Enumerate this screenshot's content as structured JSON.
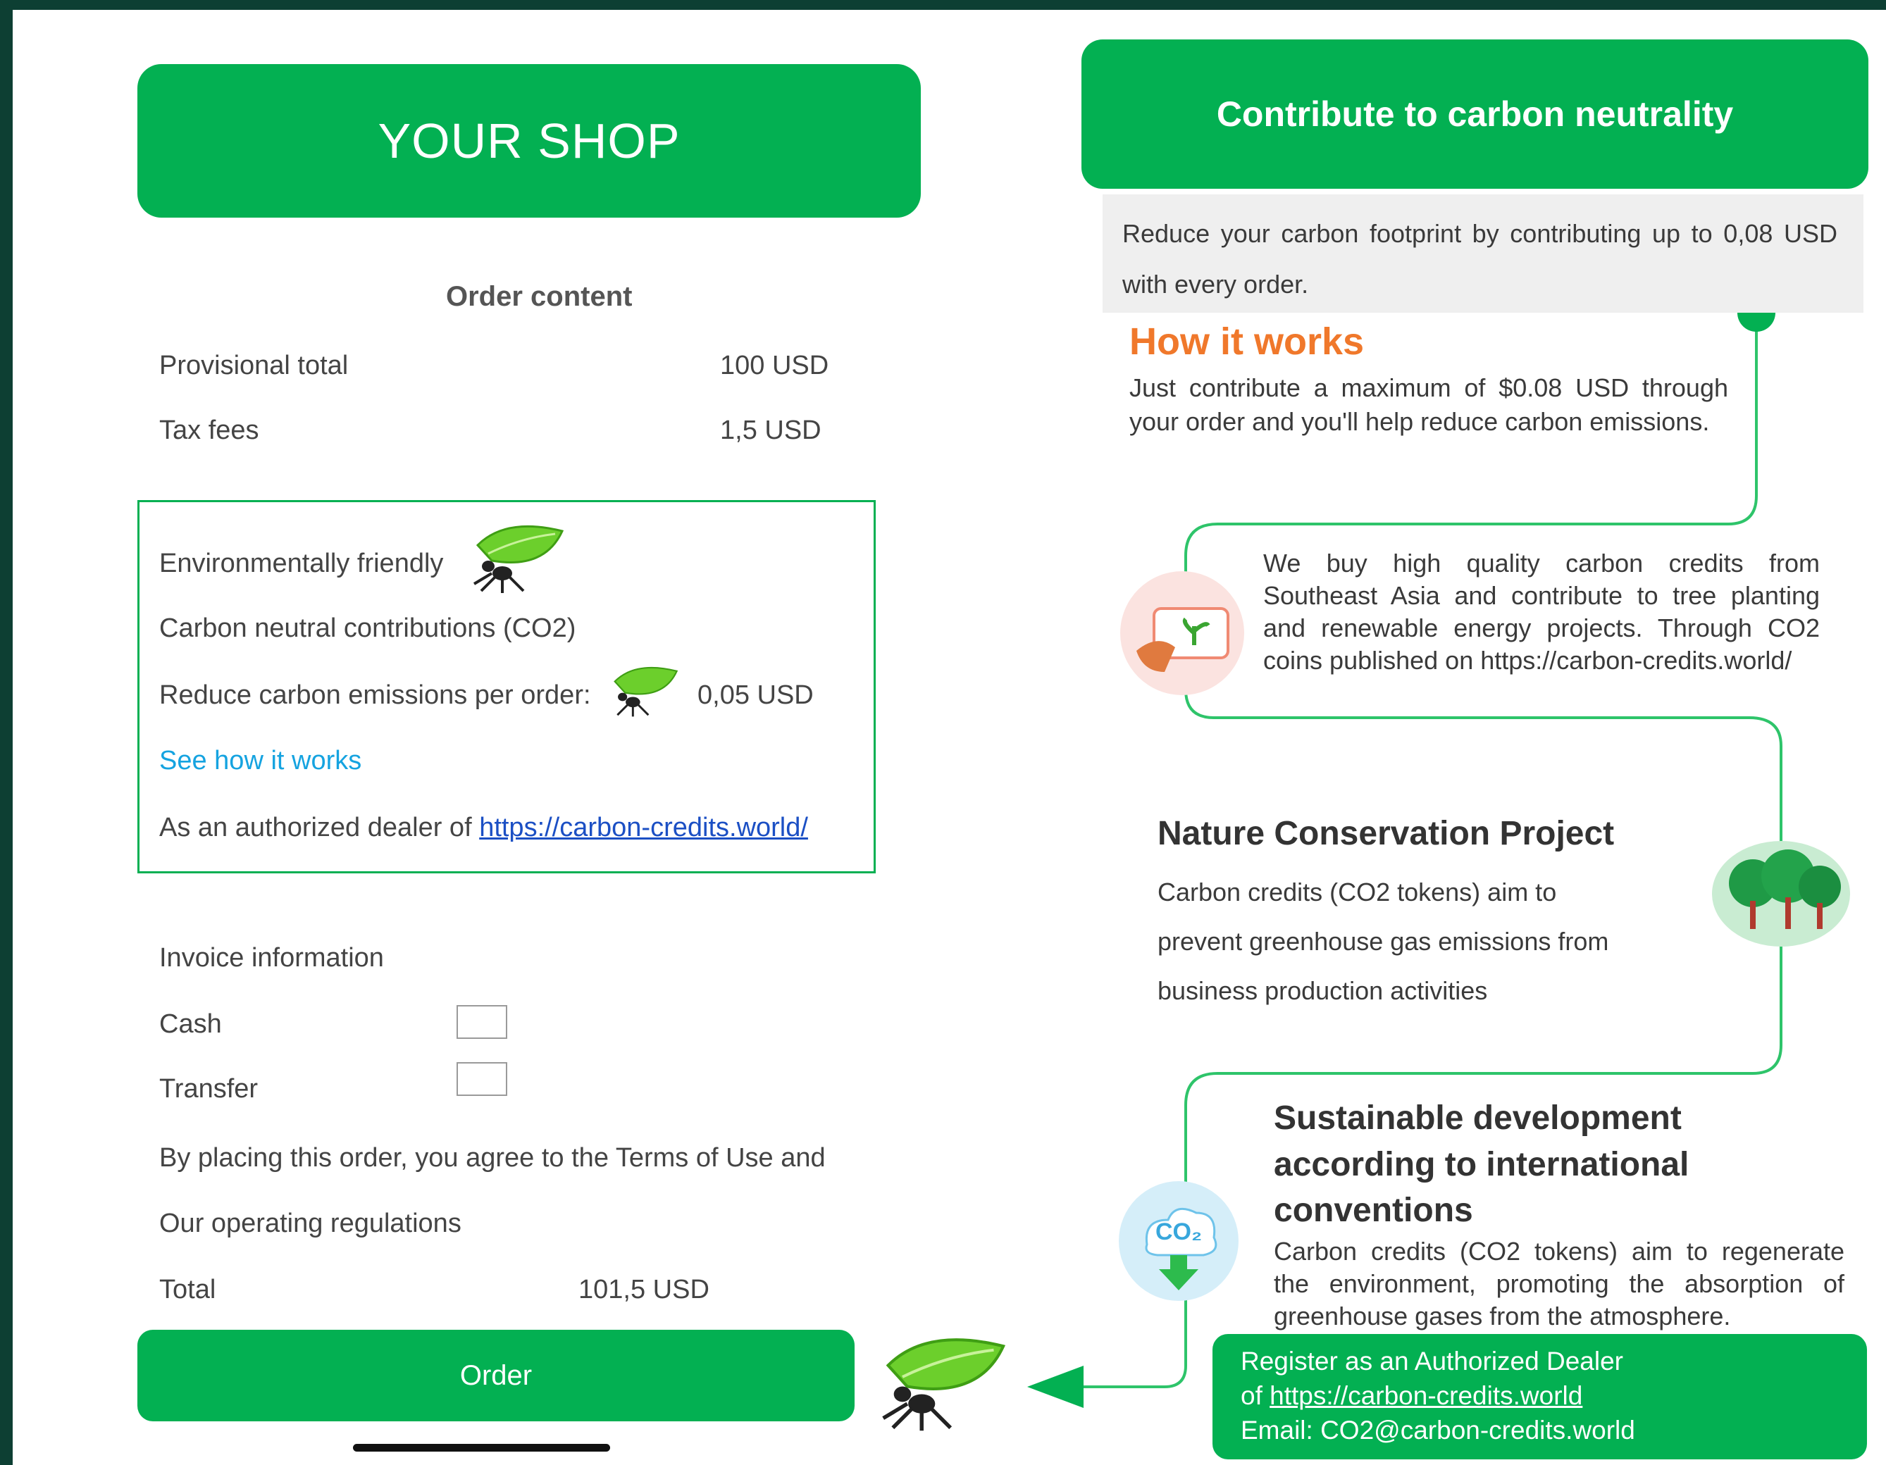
{
  "left": {
    "shop_title": "YOUR SHOP",
    "order_content_title": "Order content",
    "provisional_total_label": "Provisional total",
    "provisional_total_value": "100 USD",
    "tax_fees_label": "Tax fees",
    "tax_fees_value": "1,5 USD",
    "eco": {
      "title": "Environmentally friendly",
      "subtitle": "Carbon neutral contributions (CO2)",
      "reduce_label": "Reduce carbon emissions per order:",
      "reduce_value": "0,05 USD",
      "see_how": "See how it works",
      "dealer_prefix": "As an authorized dealer of ",
      "dealer_link": "https://carbon-credits.world/"
    },
    "invoice_label": "Invoice information",
    "cash_label": "Cash",
    "transfer_label": "Transfer",
    "terms_line1": "By placing this order, you agree to the Terms of Use and",
    "terms_line2": "Our operating regulations",
    "total_label": "Total",
    "total_value": "101,5 USD",
    "order_button": "Order"
  },
  "right": {
    "banner_title": "Contribute to carbon neutrality",
    "reduce_text": "Reduce your carbon footprint by contributing up to 0,08 USD with every order.",
    "how_title": "How it works",
    "how_text": "Just contribute a maximum of $0.08 USD through your order and you'll help reduce carbon emissions.",
    "credits_text": "We buy high quality carbon credits from Southeast Asia and contribute to tree planting and renewable energy projects. Through CO2 coins published on https://carbon-credits.world/",
    "nature_title": "Nature Conservation Project",
    "nature_line1": "Carbon credits (CO2 tokens) aim to",
    "nature_line2": "prevent greenhouse gas emissions from",
    "nature_line3": "business production activities",
    "sustain_line1": "Sustainable development",
    "sustain_line2": "according to international",
    "sustain_line3": "conventions",
    "sustain_text": "Carbon credits (CO2 tokens) aim to regenerate the environment, promoting the absorption of greenhouse gases from the atmosphere.",
    "co2_icon_label": "CO₂",
    "dealer_line1": "Register as an Authorized Dealer",
    "dealer_line2_prefix": "of ",
    "dealer_link": "https://carbon-credits.world",
    "dealer_line3": "Email: CO2@carbon-credits.world"
  },
  "colors": {
    "brand_green": "#03b052",
    "orange": "#f0782b",
    "link_blue": "#15a3e0"
  },
  "icons": [
    "ant-leaf-icon",
    "hand-plant-icon",
    "trees-icon",
    "co2-cloud-icon",
    "arrow-left-icon"
  ]
}
